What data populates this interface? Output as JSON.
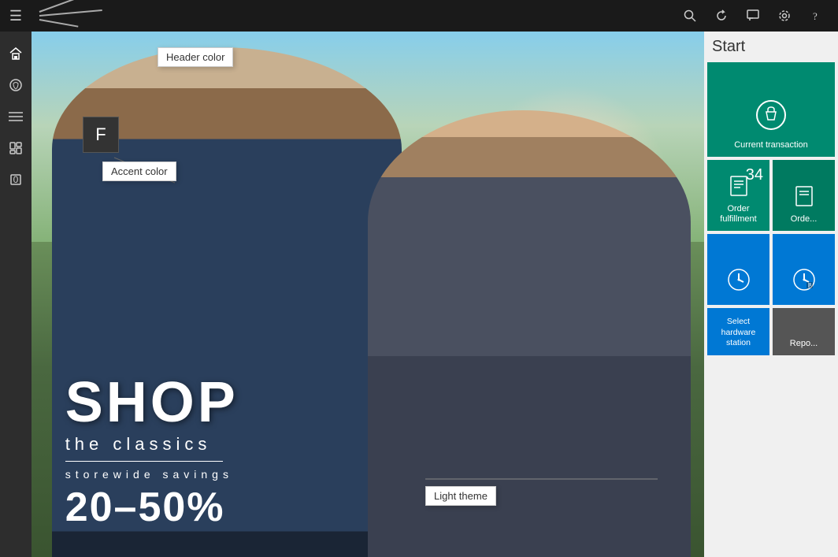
{
  "topbar": {
    "menu_icon": "≡",
    "search_icon": "🔍",
    "refresh_icon": "↻",
    "comment_icon": "💬",
    "settings_icon": "⚙",
    "help_icon": "?"
  },
  "sidebar": {
    "items": [
      {
        "id": "home",
        "icon": "⌂",
        "label": "Home",
        "active": true
      },
      {
        "id": "orders",
        "icon": "🎁",
        "label": "Orders"
      },
      {
        "id": "menu",
        "icon": "≡",
        "label": "Menu"
      },
      {
        "id": "products",
        "icon": "🏷",
        "label": "Products"
      },
      {
        "id": "badge",
        "icon": "0",
        "label": "Badge",
        "badge": "0"
      }
    ]
  },
  "hero": {
    "shop_text": "SHOP",
    "classics_text": "the classics",
    "storewide_text": "storewide savings",
    "discount_text": "20–50%"
  },
  "tooltips": {
    "header_color": "Header color",
    "accent_color": "Accent color",
    "light_theme": "Light theme",
    "f_label": "F"
  },
  "right_panel": {
    "title": "Start",
    "tiles": [
      {
        "id": "current-transaction",
        "label": "Current transaction",
        "icon": "🛍",
        "color": "#008a70",
        "span": 2,
        "badge": ""
      },
      {
        "id": "order-fulfillment",
        "label": "Order fulfillment",
        "icon": "📋",
        "color": "#008a70",
        "badge": "34"
      },
      {
        "id": "order-next",
        "label": "Orde...",
        "icon": "📋",
        "color": "#007a60",
        "badge": ""
      },
      {
        "id": "clock1",
        "label": "",
        "icon": "🕐",
        "color": "#0078d4",
        "badge": ""
      },
      {
        "id": "clock2",
        "label": "",
        "icon": "🕐",
        "color": "#0078d4",
        "badge": ""
      },
      {
        "id": "select-hardware",
        "label": "Select hardware station",
        "icon": "",
        "color": "#0078d4",
        "badge": ""
      },
      {
        "id": "reports",
        "label": "Repo...",
        "icon": "",
        "color": "#555",
        "badge": ""
      }
    ]
  }
}
